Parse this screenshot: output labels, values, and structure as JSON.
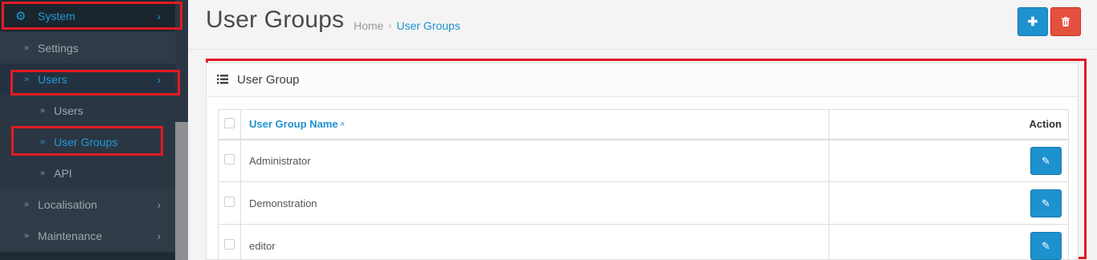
{
  "sidebar": {
    "items": [
      {
        "label": "System",
        "icon": "gear-icon",
        "expanded": true
      },
      {
        "label": "Settings"
      },
      {
        "label": "Users",
        "expanded": true
      },
      {
        "label": "Users"
      },
      {
        "label": "User Groups",
        "active": true
      },
      {
        "label": "API"
      },
      {
        "label": "Localisation"
      },
      {
        "label": "Maintenance"
      }
    ]
  },
  "header": {
    "title": "User Groups",
    "breadcrumb": [
      "Home",
      "User Groups"
    ],
    "add_icon": "plus-icon",
    "delete_icon": "trash-icon"
  },
  "panel": {
    "title": "User Group",
    "columns": [
      "User Group Name",
      "Action"
    ],
    "rows": [
      {
        "name": "Administrator"
      },
      {
        "name": "Demonstration"
      },
      {
        "name": "editor"
      }
    ]
  },
  "colors": {
    "accent": "#1e91cf",
    "danger": "#e3503e",
    "sidebar_bg": "#2b3643",
    "highlight": "#e31b23"
  }
}
